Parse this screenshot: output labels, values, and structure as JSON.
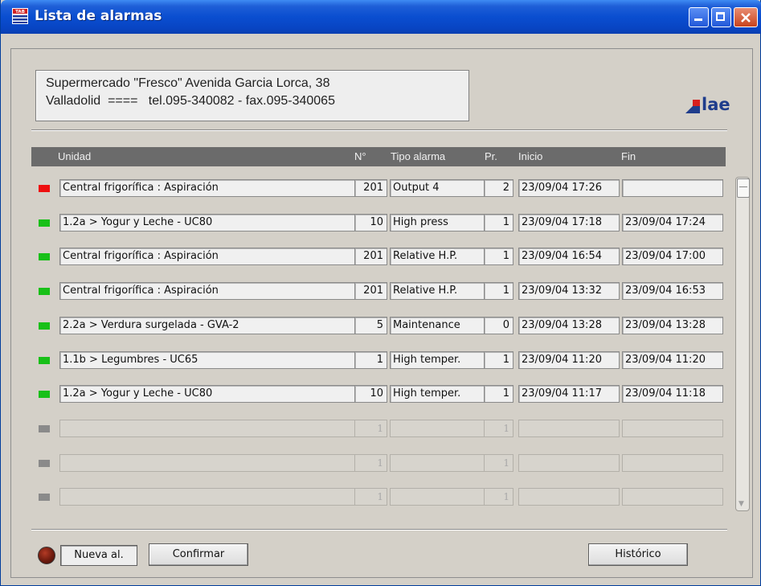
{
  "window": {
    "title": "Lista de alarmas",
    "icon": "app-logo-icon"
  },
  "info": {
    "line1": "Supermercado \"Fresco\" Avenida Garcia Lorca, 38",
    "line2": "Valladolid  ====   tel.095-340082 - fax.095-340065"
  },
  "logo": {
    "text": "lae",
    "color": "#1f3d8c",
    "accent": "#d8201e"
  },
  "table": {
    "headers": {
      "unidad": "Unidad",
      "no": "N°",
      "tipo": "Tipo alarma",
      "pr": "Pr.",
      "inicio": "Inicio",
      "fin": "Fin"
    },
    "rows": [
      {
        "status": "active",
        "unidad": "Central frigorífica : Aspiración",
        "no": "201",
        "tipo": "Output 4",
        "pr": "2",
        "inicio": "23/09/04  17:26",
        "fin": ""
      },
      {
        "status": "ok",
        "unidad": "1.2a > Yogur y Leche - UC80",
        "no": "10",
        "tipo": "High press",
        "pr": "1",
        "inicio": "23/09/04  17:18",
        "fin": "23/09/04  17:24"
      },
      {
        "status": "ok",
        "unidad": "Central frigorífica : Aspiración",
        "no": "201",
        "tipo": "Relative H.P.",
        "pr": "1",
        "inicio": "23/09/04  16:54",
        "fin": "23/09/04  17:00"
      },
      {
        "status": "ok",
        "unidad": "Central frigorífica : Aspiración",
        "no": "201",
        "tipo": "Relative H.P.",
        "pr": "1",
        "inicio": "23/09/04  13:32",
        "fin": "23/09/04  16:53"
      },
      {
        "status": "ok",
        "unidad": "2.2a > Verdura surgelada - GVA-2",
        "no": "5",
        "tipo": "Maintenance",
        "pr": "0",
        "inicio": "23/09/04  13:28",
        "fin": "23/09/04  13:28"
      },
      {
        "status": "ok",
        "unidad": "1.1b > Legumbres - UC65",
        "no": "1",
        "tipo": "High temper.",
        "pr": "1",
        "inicio": "23/09/04  11:20",
        "fin": "23/09/04  11:20"
      },
      {
        "status": "ok",
        "unidad": "1.2a > Yogur y Leche - UC80",
        "no": "10",
        "tipo": "High temper.",
        "pr": "1",
        "inicio": "23/09/04  11:17",
        "fin": "23/09/04  11:18"
      },
      {
        "status": "empty",
        "unidad": "",
        "no": "1",
        "tipo": "",
        "pr": "1",
        "inicio": "",
        "fin": ""
      },
      {
        "status": "empty",
        "unidad": "",
        "no": "1",
        "tipo": "",
        "pr": "1",
        "inicio": "",
        "fin": ""
      },
      {
        "status": "empty",
        "unidad": "",
        "no": "1",
        "tipo": "",
        "pr": "1",
        "inicio": "",
        "fin": ""
      }
    ]
  },
  "status_colors": {
    "active": "#ee1010",
    "ok": "#18c018",
    "empty": "#8a8a8a"
  },
  "buttons": {
    "nueva": "Nueva al.",
    "confirmar": "Confirmar",
    "historico": "Histórico"
  }
}
